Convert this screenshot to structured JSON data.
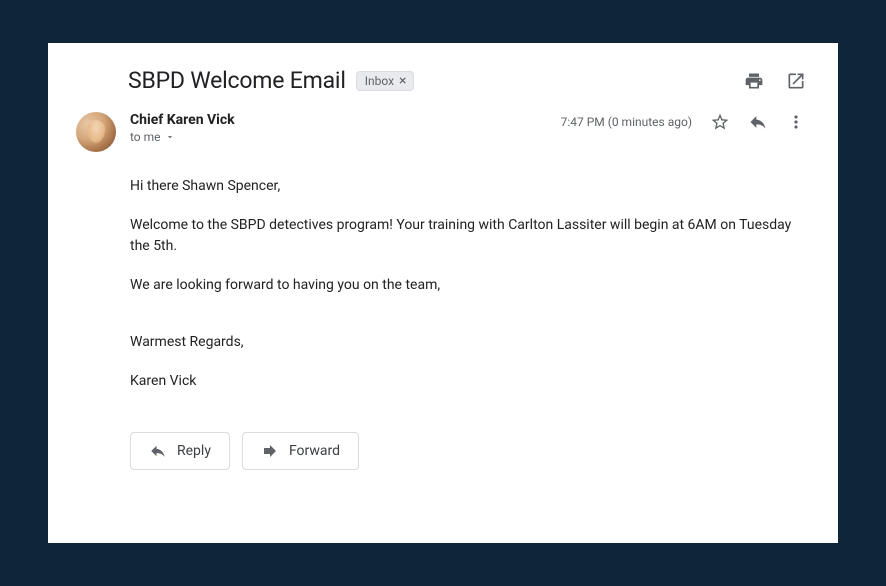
{
  "subject": "SBPD Welcome Email",
  "label": {
    "name": "Inbox",
    "remove": "×"
  },
  "sender": {
    "name": "Chief Karen Vick",
    "recipient_text": "to me"
  },
  "timestamp": "7:47 PM (0 minutes ago)",
  "body": {
    "greeting": "Hi there Shawn Spencer,",
    "p1": "Welcome to the SBPD detectives program! Your training with Carlton Lassiter will begin at 6AM on Tuesday the 5th.",
    "p2": "We are looking forward to having you on the team,",
    "signoff": "Warmest Regards,",
    "signature": "Karen Vick"
  },
  "actions": {
    "reply": "Reply",
    "forward": "Forward"
  }
}
